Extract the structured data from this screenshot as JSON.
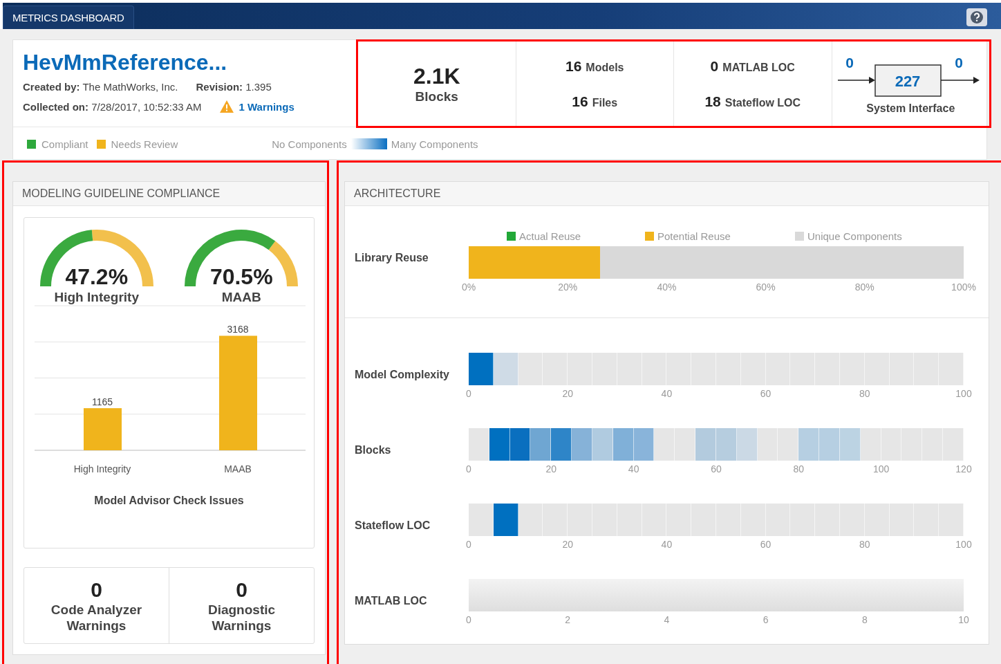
{
  "app_bar": {
    "title": "METRICS DASHBOARD"
  },
  "summary": {
    "model_name": "HevMmReference...",
    "details": [
      {
        "label": "Created by:",
        "value": "The MathWorks, Inc."
      },
      {
        "label": "Revision:",
        "value": "1.395"
      },
      {
        "label": "Collected on:",
        "value": "7/28/2017, 10:52:33 AM"
      }
    ],
    "warnings": "1 Warnings",
    "highlighted": true,
    "stats": [
      {
        "kind": "single",
        "value": "2.1K",
        "label": "Blocks"
      },
      {
        "kind": "pair",
        "items": [
          {
            "value": "16",
            "label": "Models"
          },
          {
            "value": "16",
            "label": "Files"
          }
        ]
      },
      {
        "kind": "pair",
        "items": [
          {
            "value": "0",
            "label": "MATLAB LOC"
          },
          {
            "value": "18",
            "label": "Stateflow LOC"
          }
        ]
      },
      {
        "kind": "interface",
        "inputs": "0",
        "blocks": "227",
        "outputs": "0",
        "label": "System Interface"
      }
    ],
    "legend": [
      {
        "label": "Compliant",
        "color": "#2ea83c"
      },
      {
        "label": "Needs Review",
        "color": "#f0b41c"
      }
    ],
    "scale": {
      "low": "No Components",
      "high": "Many Components"
    }
  },
  "compliance": {
    "title": "MODELING GUIDELINE COMPLIANCE",
    "highlighted": true,
    "gauges": [
      {
        "value": "47.2%",
        "label": "High Integrity"
      },
      {
        "value": "70.5%",
        "label": "MAAB"
      }
    ],
    "chart_data": {
      "type": "bar",
      "title": "Model Advisor Check Issues",
      "categories": [
        "High Integrity",
        "MAAB"
      ],
      "values": [
        1165,
        3168
      ],
      "ylim": [
        0,
        4000
      ],
      "data_labels": true
    },
    "counters": [
      {
        "value": "0",
        "label": "Code Analyzer Warnings"
      },
      {
        "value": "0",
        "label": "Diagnostic Warnings"
      }
    ]
  },
  "architecture": {
    "title": "ARCHITECTURE",
    "highlighted": true,
    "library_reuse": {
      "label": "Library Reuse",
      "legend": [
        {
          "label": "Actual Reuse",
          "color": "#22a838"
        },
        {
          "label": "Potential Reuse",
          "color": "#f0b41c"
        },
        {
          "label": "Unique Components",
          "color": "#d9d9d9"
        }
      ],
      "segments": [
        {
          "level": 0.265,
          "color": "#f0b41c"
        },
        {
          "level": 0.735,
          "color": "#d9d9d9"
        }
      ],
      "ticks": [
        "0%",
        "20%",
        "40%",
        "60%",
        "80%",
        "100%"
      ]
    },
    "distributions": [
      {
        "label": "Model Complexity",
        "ticks": [
          "0",
          "20",
          "40",
          "60",
          "80",
          "100"
        ],
        "bins": [
          {
            "color": "#0070c0"
          },
          {
            "color": "#cfdbe6"
          },
          {
            "color": "#e6e6e6"
          },
          {
            "color": "#e6e6e6"
          },
          {
            "color": "#e6e6e6"
          },
          {
            "color": "#e6e6e6"
          },
          {
            "color": "#e6e6e6"
          },
          {
            "color": "#e6e6e6"
          },
          {
            "color": "#e6e6e6"
          },
          {
            "color": "#e6e6e6"
          },
          {
            "color": "#e6e6e6"
          },
          {
            "color": "#e6e6e6"
          },
          {
            "color": "#e6e6e6"
          },
          {
            "color": "#e6e6e6"
          },
          {
            "color": "#e6e6e6"
          },
          {
            "color": "#e6e6e6"
          },
          {
            "color": "#e6e6e6"
          },
          {
            "color": "#e6e6e6"
          },
          {
            "color": "#e6e6e6"
          },
          {
            "color": "#e6e6e6"
          }
        ]
      },
      {
        "label": "Blocks",
        "ticks": [
          "0",
          "20",
          "40",
          "60",
          "80",
          "100",
          "120"
        ],
        "bins": [
          {
            "color": "#e6e6e6"
          },
          {
            "color": "#0070c0"
          },
          {
            "color": "#0a6fbf"
          },
          {
            "color": "#6fa6d2"
          },
          {
            "color": "#2e85c8"
          },
          {
            "color": "#86b2d8"
          },
          {
            "color": "#b0cbe0"
          },
          {
            "color": "#80b0d8"
          },
          {
            "color": "#89b4da"
          },
          {
            "color": "#e6e6e6"
          },
          {
            "color": "#e6e6e6"
          },
          {
            "color": "#b3cbde"
          },
          {
            "color": "#b6cddf"
          },
          {
            "color": "#cbd9e5"
          },
          {
            "color": "#e6e6e6"
          },
          {
            "color": "#e6e6e6"
          },
          {
            "color": "#b6cfe2"
          },
          {
            "color": "#b6cfe2"
          },
          {
            "color": "#bcd3e3"
          },
          {
            "color": "#e6e6e6"
          },
          {
            "color": "#e6e6e6"
          },
          {
            "color": "#e6e6e6"
          },
          {
            "color": "#e6e6e6"
          },
          {
            "color": "#e6e6e6"
          }
        ]
      },
      {
        "label": "Stateflow LOC",
        "ticks": [
          "0",
          "20",
          "40",
          "60",
          "80",
          "100"
        ],
        "bins": [
          {
            "color": "#e6e6e6"
          },
          {
            "color": "#0070c0"
          },
          {
            "color": "#e6e6e6"
          },
          {
            "color": "#e6e6e6"
          },
          {
            "color": "#e6e6e6"
          },
          {
            "color": "#e6e6e6"
          },
          {
            "color": "#e6e6e6"
          },
          {
            "color": "#e6e6e6"
          },
          {
            "color": "#e6e6e6"
          },
          {
            "color": "#e6e6e6"
          },
          {
            "color": "#e6e6e6"
          },
          {
            "color": "#e6e6e6"
          },
          {
            "color": "#e6e6e6"
          },
          {
            "color": "#e6e6e6"
          },
          {
            "color": "#e6e6e6"
          },
          {
            "color": "#e6e6e6"
          },
          {
            "color": "#e6e6e6"
          },
          {
            "color": "#e6e6e6"
          },
          {
            "color": "#e6e6e6"
          },
          {
            "color": "#e6e6e6"
          }
        ]
      },
      {
        "label": "MATLAB LOC",
        "ticks": [
          "0",
          "2",
          "4",
          "6",
          "8",
          "10"
        ]
      }
    ]
  }
}
